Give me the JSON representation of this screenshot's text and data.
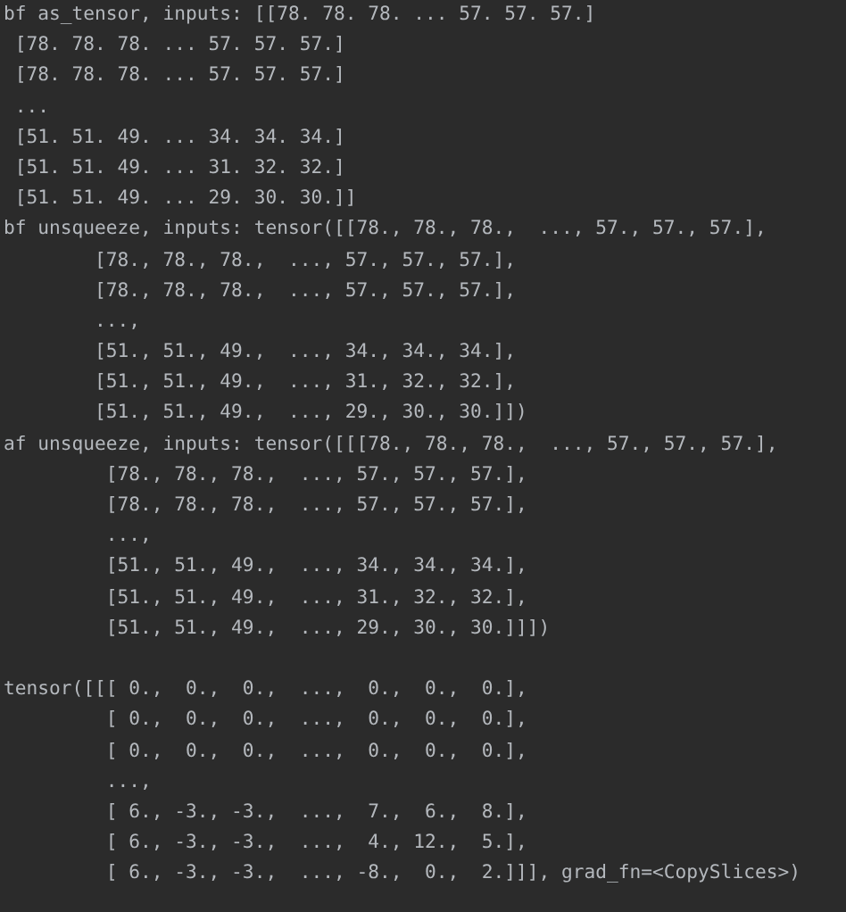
{
  "console": {
    "groups": [
      {
        "lines": [
          "bf as_tensor, inputs: [[78. 78. 78. ... 57. 57. 57.]",
          " [78. 78. 78. ... 57. 57. 57.]",
          " [78. 78. 78. ... 57. 57. 57.]",
          " ...",
          " [51. 51. 49. ... 34. 34. 34.]",
          " [51. 51. 49. ... 31. 32. 32.]",
          " [51. 51. 49. ... 29. 30. 30.]]",
          "bf unsqueeze, inputs: tensor([[78., 78., 78.,  ..., 57., 57., 57.],",
          "        [78., 78., 78.,  ..., 57., 57., 57.],",
          "        [78., 78., 78.,  ..., 57., 57., 57.],",
          "        ...,",
          "        [51., 51., 49.,  ..., 34., 34., 34.],",
          "        [51., 51., 49.,  ..., 31., 32., 32.],",
          "        [51., 51., 49.,  ..., 29., 30., 30.]])",
          "af unsqueeze, inputs: tensor([[[78., 78., 78.,  ..., 57., 57., 57.],",
          "         [78., 78., 78.,  ..., 57., 57., 57.],",
          "         [78., 78., 78.,  ..., 57., 57., 57.],",
          "         ...,",
          "         [51., 51., 49.,  ..., 34., 34., 34.],",
          "         [51., 51., 49.,  ..., 31., 32., 32.],",
          "         [51., 51., 49.,  ..., 29., 30., 30.]]])"
        ]
      },
      {
        "lines": [
          "tensor([[[ 0.,  0.,  0.,  ...,  0.,  0.,  0.],",
          "         [ 0.,  0.,  0.,  ...,  0.,  0.,  0.],",
          "         [ 0.,  0.,  0.,  ...,  0.,  0.,  0.],",
          "         ...,",
          "         [ 6., -3., -3.,  ...,  7.,  6.,  8.],",
          "         [ 6., -3., -3.,  ...,  4., 12.,  5.],",
          "         [ 6., -3., -3.,  ..., -8.,  0.,  2.]]], grad_fn=<CopySlices>)"
        ]
      }
    ]
  }
}
